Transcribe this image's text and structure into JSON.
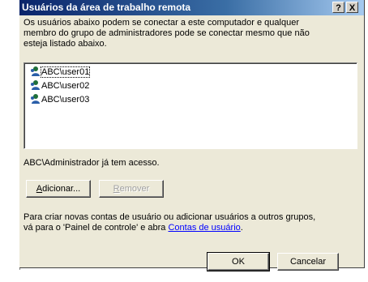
{
  "window": {
    "title": "Usuários da área de trabalho remota",
    "help_label": "?",
    "close_label": "X"
  },
  "description": "Os usuários abaixo podem se conectar a este computador e qualquer\nmembro do grupo de administradores pode se conectar mesmo que não\nesteja listado abaixo.",
  "users": [
    {
      "name": "ABC\\user01",
      "icon": "user-icon",
      "selected": true
    },
    {
      "name": "ABC\\user02",
      "icon": "user-icon",
      "selected": false
    },
    {
      "name": "ABC\\user03",
      "icon": "user-icon",
      "selected": false
    }
  ],
  "access_note": "ABC\\Administrador já tem acesso.",
  "buttons": {
    "add_label": "Adicionar...",
    "add_accel": "A",
    "add_rest": "dicionar...",
    "remove_label": "Remover",
    "remove_accel": "R",
    "remove_rest": "emover",
    "ok_label": "OK",
    "cancel_label": "Cancelar"
  },
  "footer": {
    "text_before": "Para criar novas contas de usuário ou adicionar usuários a outros grupos,\nvá para o 'Painel de controle' e abra ",
    "link_text": "Contas de usuário",
    "text_after": "."
  },
  "colors": {
    "titlebar_start": "#0a246a",
    "titlebar_end": "#a6caf0",
    "dialog_bg": "#ece9d8",
    "link": "#0000ff"
  }
}
